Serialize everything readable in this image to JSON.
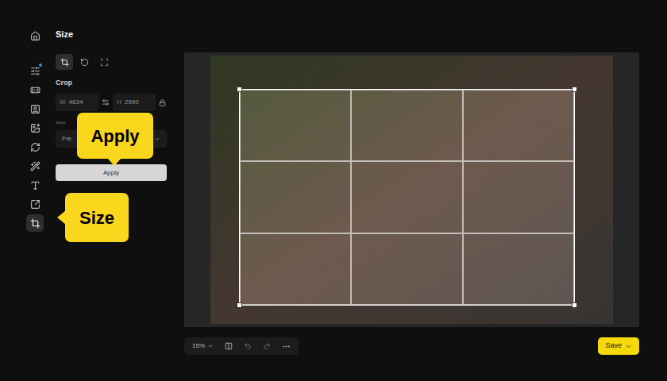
{
  "rail": {
    "items": [
      {
        "selected": false,
        "dot": false
      },
      {
        "selected": false,
        "dot": true
      },
      {
        "selected": false,
        "dot": false
      },
      {
        "selected": false,
        "dot": false
      },
      {
        "selected": false,
        "dot": false
      },
      {
        "selected": false,
        "dot": false
      },
      {
        "selected": false,
        "dot": false
      },
      {
        "selected": false,
        "dot": false
      },
      {
        "selected": false,
        "dot": false
      },
      {
        "selected": true,
        "dot": false
      }
    ]
  },
  "panel": {
    "title": "Size",
    "tabs": [
      {
        "selected": true
      },
      {
        "selected": false
      },
      {
        "selected": false
      }
    ],
    "section": "Crop",
    "width": {
      "label": "W",
      "value": "4634"
    },
    "height": {
      "label": "H",
      "value": "2990"
    },
    "aspect_label": "aspe",
    "aspect_value": "Fre",
    "apply": "Apply"
  },
  "callouts": [
    {
      "text": "Apply"
    },
    {
      "text": "Size"
    }
  ],
  "toolbar": {
    "zoom": "15%"
  },
  "save": {
    "label": "Save"
  }
}
